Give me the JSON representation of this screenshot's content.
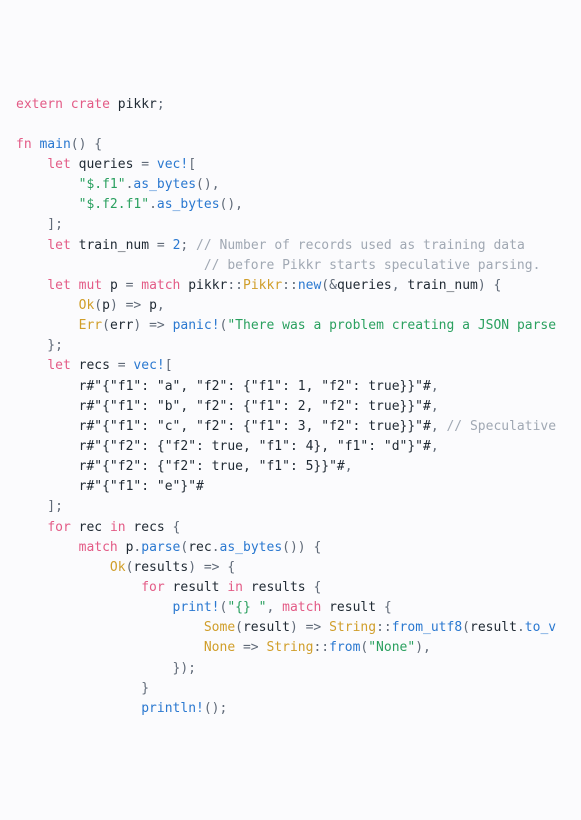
{
  "code": {
    "lines": [
      [
        [
          "extern crate",
          "kw"
        ],
        [
          " ",
          "pun"
        ],
        [
          "pikkr",
          "id"
        ],
        [
          ";",
          "pun"
        ]
      ],
      [],
      [
        [
          "fn",
          "kw"
        ],
        [
          " ",
          "pun"
        ],
        [
          "main",
          "fn"
        ],
        [
          "() {",
          "pun"
        ]
      ],
      [
        [
          "    ",
          "pun"
        ],
        [
          "let",
          "kw"
        ],
        [
          " ",
          "pun"
        ],
        [
          "queries",
          "id"
        ],
        [
          " = ",
          "pun"
        ],
        [
          "vec!",
          "mac"
        ],
        [
          "[",
          "pun"
        ]
      ],
      [
        [
          "        ",
          "pun"
        ],
        [
          "\"$.f1\"",
          "str"
        ],
        [
          ".",
          "pun"
        ],
        [
          "as_bytes",
          "fn"
        ],
        [
          "(),",
          "pun"
        ]
      ],
      [
        [
          "        ",
          "pun"
        ],
        [
          "\"$.f2.f1\"",
          "str"
        ],
        [
          ".",
          "pun"
        ],
        [
          "as_bytes",
          "fn"
        ],
        [
          "(),",
          "pun"
        ]
      ],
      [
        [
          "    ];",
          "pun"
        ]
      ],
      [
        [
          "    ",
          "pun"
        ],
        [
          "let",
          "kw"
        ],
        [
          " ",
          "pun"
        ],
        [
          "train_num",
          "id"
        ],
        [
          " = ",
          "pun"
        ],
        [
          "2",
          "num"
        ],
        [
          "; ",
          "pun"
        ],
        [
          "// Number of records used as training data",
          "com"
        ]
      ],
      [
        [
          "                        ",
          "pun"
        ],
        [
          "// before Pikkr starts speculative parsing.",
          "com"
        ]
      ],
      [
        [
          "    ",
          "pun"
        ],
        [
          "let",
          "kw"
        ],
        [
          " ",
          "pun"
        ],
        [
          "mut",
          "kw"
        ],
        [
          " ",
          "pun"
        ],
        [
          "p",
          "id"
        ],
        [
          " = ",
          "pun"
        ],
        [
          "match",
          "kw"
        ],
        [
          " ",
          "pun"
        ],
        [
          "pikkr",
          "id"
        ],
        [
          "::",
          "pun"
        ],
        [
          "Pikkr",
          "ty"
        ],
        [
          "::",
          "pun"
        ],
        [
          "new",
          "fn"
        ],
        [
          "(&",
          "pun"
        ],
        [
          "queries",
          "id"
        ],
        [
          ", ",
          "pun"
        ],
        [
          "train_num",
          "id"
        ],
        [
          ") {",
          "pun"
        ]
      ],
      [
        [
          "        ",
          "pun"
        ],
        [
          "Ok",
          "ty"
        ],
        [
          "(",
          "pun"
        ],
        [
          "p",
          "id"
        ],
        [
          ") => ",
          "pun"
        ],
        [
          "p",
          "id"
        ],
        [
          ",",
          "pun"
        ]
      ],
      [
        [
          "        ",
          "pun"
        ],
        [
          "Err",
          "ty"
        ],
        [
          "(",
          "pun"
        ],
        [
          "err",
          "id"
        ],
        [
          ") => ",
          "pun"
        ],
        [
          "panic!",
          "mac"
        ],
        [
          "(",
          "pun"
        ],
        [
          "\"There was a problem creating a JSON parse",
          "str"
        ]
      ],
      [
        [
          "    };",
          "pun"
        ]
      ],
      [
        [
          "    ",
          "pun"
        ],
        [
          "let",
          "kw"
        ],
        [
          " ",
          "pun"
        ],
        [
          "recs",
          "id"
        ],
        [
          " = ",
          "pun"
        ],
        [
          "vec!",
          "mac"
        ],
        [
          "[",
          "pun"
        ]
      ],
      [
        [
          "        ",
          "pun"
        ],
        [
          "r#\"{\"f1\": \"a\", \"f2\": {\"f1\": 1, \"f2\": true}}\"#",
          "id"
        ],
        [
          ",",
          "pun"
        ]
      ],
      [
        [
          "        ",
          "pun"
        ],
        [
          "r#\"{\"f1\": \"b\", \"f2\": {\"f1\": 2, \"f2\": true}}\"#",
          "id"
        ],
        [
          ",",
          "pun"
        ]
      ],
      [
        [
          "        ",
          "pun"
        ],
        [
          "r#\"{\"f1\": \"c\", \"f2\": {\"f1\": 3, \"f2\": true}}\"#",
          "id"
        ],
        [
          ", ",
          "pun"
        ],
        [
          "// Speculative",
          "com"
        ]
      ],
      [
        [
          "        ",
          "pun"
        ],
        [
          "r#\"{\"f2\": {\"f2\": true, \"f1\": 4}, \"f1\": \"d\"}\"#",
          "id"
        ],
        [
          ",",
          "pun"
        ]
      ],
      [
        [
          "        ",
          "pun"
        ],
        [
          "r#\"{\"f2\": {\"f2\": true, \"f1\": 5}}\"#",
          "id"
        ],
        [
          ",",
          "pun"
        ]
      ],
      [
        [
          "        ",
          "pun"
        ],
        [
          "r#\"{\"f1\": \"e\"}\"#",
          "id"
        ]
      ],
      [
        [
          "    ];",
          "pun"
        ]
      ],
      [
        [
          "    ",
          "pun"
        ],
        [
          "for",
          "kw"
        ],
        [
          " ",
          "pun"
        ],
        [
          "rec",
          "id"
        ],
        [
          " ",
          "pun"
        ],
        [
          "in",
          "kw"
        ],
        [
          " ",
          "pun"
        ],
        [
          "recs",
          "id"
        ],
        [
          " {",
          "pun"
        ]
      ],
      [
        [
          "        ",
          "pun"
        ],
        [
          "match",
          "kw"
        ],
        [
          " ",
          "pun"
        ],
        [
          "p",
          "id"
        ],
        [
          ".",
          "pun"
        ],
        [
          "parse",
          "fn"
        ],
        [
          "(",
          "pun"
        ],
        [
          "rec",
          "id"
        ],
        [
          ".",
          "pun"
        ],
        [
          "as_bytes",
          "fn"
        ],
        [
          "()) {",
          "pun"
        ]
      ],
      [
        [
          "            ",
          "pun"
        ],
        [
          "Ok",
          "ty"
        ],
        [
          "(",
          "pun"
        ],
        [
          "results",
          "id"
        ],
        [
          ") => {",
          "pun"
        ]
      ],
      [
        [
          "                ",
          "pun"
        ],
        [
          "for",
          "kw"
        ],
        [
          " ",
          "pun"
        ],
        [
          "result",
          "id"
        ],
        [
          " ",
          "pun"
        ],
        [
          "in",
          "kw"
        ],
        [
          " ",
          "pun"
        ],
        [
          "results",
          "id"
        ],
        [
          " {",
          "pun"
        ]
      ],
      [
        [
          "                    ",
          "pun"
        ],
        [
          "print!",
          "mac"
        ],
        [
          "(",
          "pun"
        ],
        [
          "\"{} \"",
          "str"
        ],
        [
          ", ",
          "pun"
        ],
        [
          "match",
          "kw"
        ],
        [
          " ",
          "pun"
        ],
        [
          "result",
          "id"
        ],
        [
          " {",
          "pun"
        ]
      ],
      [
        [
          "                        ",
          "pun"
        ],
        [
          "Some",
          "ty"
        ],
        [
          "(",
          "pun"
        ],
        [
          "result",
          "id"
        ],
        [
          ") => ",
          "pun"
        ],
        [
          "String",
          "ty"
        ],
        [
          "::",
          "pun"
        ],
        [
          "from_utf8",
          "fn"
        ],
        [
          "(",
          "pun"
        ],
        [
          "result",
          "id"
        ],
        [
          ".",
          "pun"
        ],
        [
          "to_v",
          "fn"
        ]
      ],
      [
        [
          "                        ",
          "pun"
        ],
        [
          "None",
          "ty"
        ],
        [
          " => ",
          "pun"
        ],
        [
          "String",
          "ty"
        ],
        [
          "::",
          "pun"
        ],
        [
          "from",
          "fn"
        ],
        [
          "(",
          "pun"
        ],
        [
          "\"None\"",
          "str"
        ],
        [
          "),",
          "pun"
        ]
      ],
      [
        [
          "                    });",
          "pun"
        ]
      ],
      [
        [
          "                }",
          "pun"
        ]
      ],
      [
        [
          "                ",
          "pun"
        ],
        [
          "println!",
          "mac"
        ],
        [
          "();",
          "pun"
        ]
      ]
    ]
  }
}
